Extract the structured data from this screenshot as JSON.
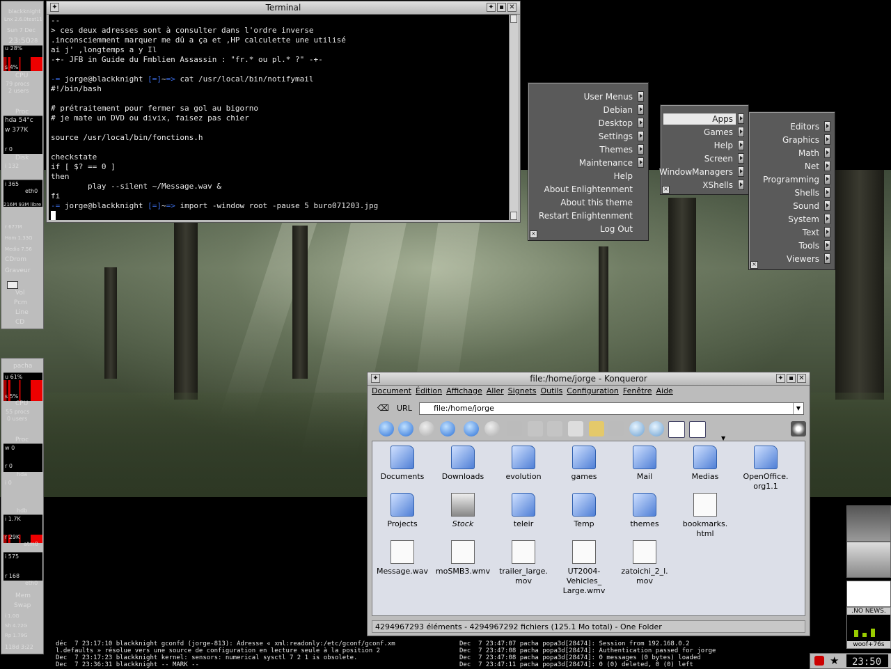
{
  "terminal": {
    "title": "Terminal",
    "lines": [
      "--",
      "> ces deux adresses sont à consulter dans l'ordre inverse",
      ".inconsciemment marquer me dû a ça et ,HP calculette une utilisé",
      "ai j' ,longtemps a y Il",
      "-+- JFB in Guide du Fmblien Assassin : \"fr.* ou pl.* ?\" -+-",
      "",
      "",
      "#!/bin/bash",
      "",
      "# prétraitement pour fermer sa gol au bigorno",
      "# je mate un DVD ou divix, faisez pas chier",
      "",
      "source /usr/local/bin/fonctions.h",
      "",
      "checkstate",
      "if [ $? == 0 ]",
      "then",
      "        play --silent ~/Message.wav &",
      "fi",
      ""
    ],
    "prompt1_user": "jorge@blackknight",
    "prompt1_cmd": "cat /usr/local/bin/notifymail",
    "prompt2_user": "jorge@blackknight",
    "prompt2_cmd": "import -window root -pause 5 buro071203.jpg",
    "prompt_sep": "~"
  },
  "menus": {
    "main": [
      "User Menus",
      "Debian",
      "Desktop",
      "Settings",
      "Themes",
      "Maintenance",
      "Help",
      "About Enlightenment",
      "About this theme",
      "Restart Enlightenment",
      "Log Out"
    ],
    "debian": [
      "Apps",
      "Games",
      "Help",
      "Screen",
      "WindowManagers",
      "XShells"
    ],
    "apps": [
      "Editors",
      "Graphics",
      "Math",
      "Net",
      "Programming",
      "Shells",
      "Sound",
      "System",
      "Text",
      "Tools",
      "Viewers"
    ]
  },
  "konqueror": {
    "title": "file:/home/jorge - Konqueror",
    "menubar": [
      "Document",
      "Édition",
      "Affichage",
      "Aller",
      "Signets",
      "Outils",
      "Configuration",
      "Fenêtre",
      "Aide"
    ],
    "url_label": "URL",
    "url": "file:/home/jorge",
    "files": [
      {
        "name": "Documents",
        "kind": "folder"
      },
      {
        "name": "Downloads",
        "kind": "folder"
      },
      {
        "name": "evolution",
        "kind": "folder"
      },
      {
        "name": "games",
        "kind": "folder"
      },
      {
        "name": "Mail",
        "kind": "folder"
      },
      {
        "name": "Medias",
        "kind": "folder"
      },
      {
        "name": "OpenOffice.\norg1.1",
        "kind": "folder"
      },
      {
        "name": "Projects",
        "kind": "folder"
      },
      {
        "name": "Stock",
        "kind": "drive"
      },
      {
        "name": "teleir",
        "kind": "folder"
      },
      {
        "name": "Temp",
        "kind": "folder"
      },
      {
        "name": "themes",
        "kind": "folder"
      },
      {
        "name": "bookmarks.\nhtml",
        "kind": "doc"
      },
      {
        "name": "",
        "kind": "none"
      },
      {
        "name": "Message.wav",
        "kind": "doc"
      },
      {
        "name": "moSMB3.wmv",
        "kind": "doc"
      },
      {
        "name": "trailer_large.\nmov",
        "kind": "doc"
      },
      {
        "name": "UT2004-\nVehicles_\nLarge.wmv",
        "kind": "doc"
      },
      {
        "name": "zatoichi_2_l.\nmov",
        "kind": "doc"
      }
    ],
    "status": "4294967293 éléments - 4294967292 fichiers (125.1 Mo total) - One Folder"
  },
  "dock_top": {
    "host": "blackknight",
    "kernel": "Lnx 2.6.0test11",
    "date": "Sun  7 Dec",
    "time": "23:50",
    "seconds": "28",
    "cpu_user": "u 28%",
    "cpu_sys": "s 4%",
    "cpu_label": "CPU",
    "procs": "79 procs",
    "users": "2 users",
    "proc_label": "Proc",
    "temp": "hda 54°c",
    "w_rate": "w 377K",
    "r_rate": "r 0",
    "disk_label": "Disk",
    "disk_val": "i 132",
    "net_val": "i 365",
    "net_label": "eth0",
    "mem": "216M 93M libre",
    "mem2": "r 677M",
    "home": "Hom 1.33G",
    "media": "Media 7.56",
    "cdrom": "CDrom",
    "graveur": "Graveur",
    "vol": "Vol",
    "pcm": "Pcm",
    "line": "Line",
    "cd": "CD"
  },
  "dock_bottom": {
    "host": "pacha",
    "cpu_user": "u 61%",
    "cpu_sys": "s 5%",
    "cpu_label": "CPU",
    "procs": "55 procs",
    "users": "0 users",
    "proc_label": "Proc",
    "w0": "w 0",
    "r0": "r 0",
    "hda": "hda",
    "i0": "i 0",
    "hdb": "hdb",
    "hdb_v": "i 1.7K",
    "hdb_r": "r 29K",
    "atm": "atm0",
    "eth_i": "i 575",
    "eth_r": "r 168",
    "eth": "eth0",
    "mem": "Mem",
    "swap": "Swap",
    "v1": "i 1.0G",
    "v2": "Sh 4.72G",
    "v3": "Rp 1.79G",
    "uptime": "118d  3:22"
  },
  "logs_left": [
    "déc  7 23:17:10 blackknight gconfd (jorge-813): Adresse « xml:readonly:/etc/gconf/gconf.xm",
    "l.defaults » résolue vers une source de configuration en lecture seule à la position 2",
    "Dec  7 23:17:23 blackknight kernel: sensors: numerical sysctl 7 2 1 is obsolete.",
    "Dec  7 23:36:31 blackknight -- MARK --"
  ],
  "logs_right": [
    "Dec  7 23:47:07 pacha popa3d[28474]: Session from 192.168.0.2",
    "Dec  7 23:47:08 pacha popa3d[28474]: Authentication passed for jorge",
    "Dec  7 23:47:08 pacha popa3d[28474]: 0 messages (0 bytes) loaded",
    "Dec  7 23:47:11 pacha popa3d[28474]: 0 (0) deleted, 0 (0) left"
  ],
  "news": ".NO NEWS.",
  "woof": "woof+76s",
  "clock": "23:50"
}
